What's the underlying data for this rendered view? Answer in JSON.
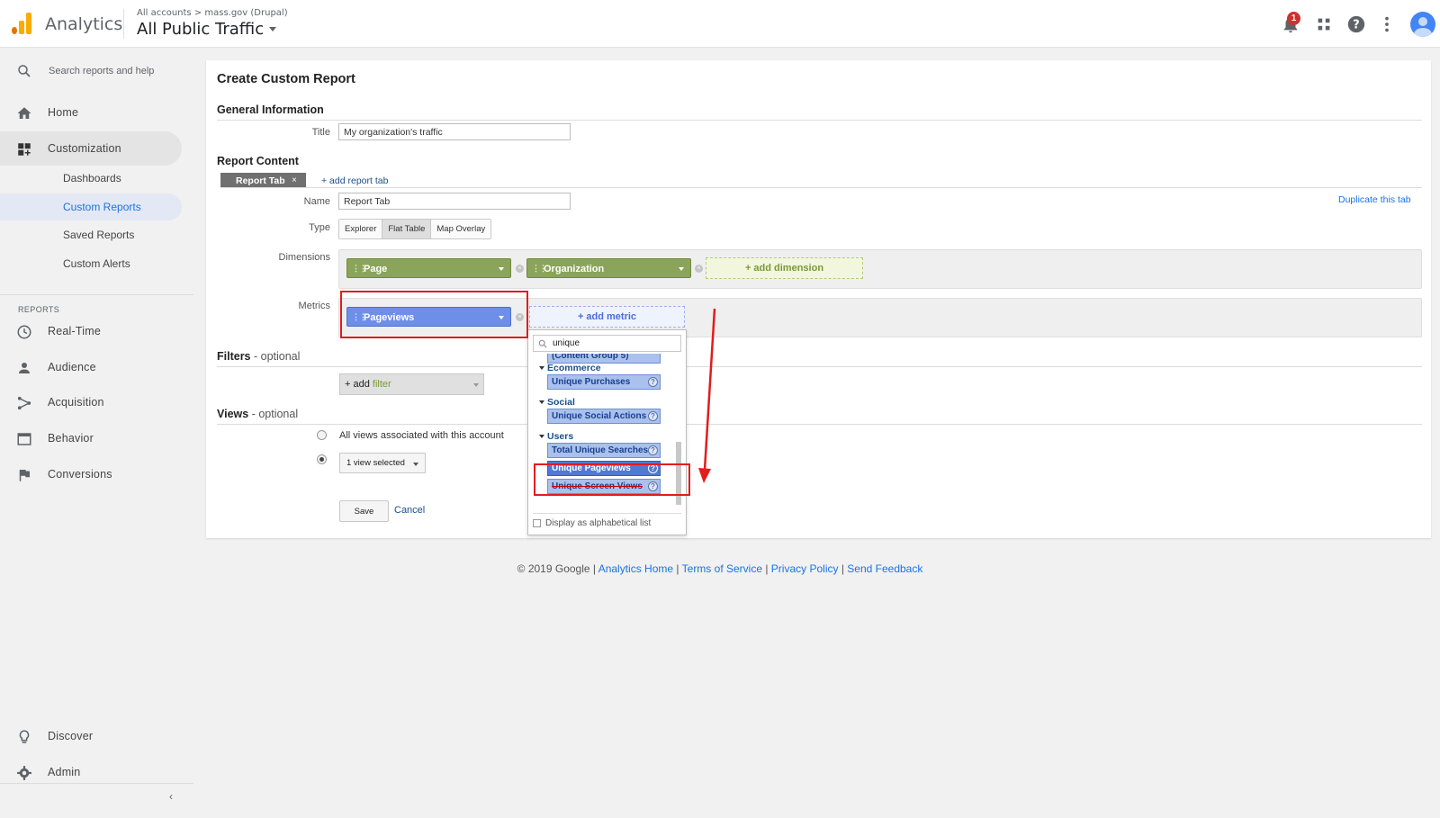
{
  "header": {
    "app_name": "Analytics",
    "breadcrumb": "All accounts > mass.gov (Drupal)",
    "view_name": "All Public Traffic",
    "notification_count": "1"
  },
  "sidebar": {
    "search_placeholder": "Search reports and help",
    "home": "Home",
    "customization": "Customization",
    "sub_items": [
      "Dashboards",
      "Custom Reports",
      "Saved Reports",
      "Custom Alerts"
    ],
    "reports_section": "REPORTS",
    "reports": [
      "Real-Time",
      "Audience",
      "Acquisition",
      "Behavior",
      "Conversions"
    ],
    "discover": "Discover",
    "admin": "Admin"
  },
  "main": {
    "page_title": "Create Custom Report",
    "general_info": "General Information",
    "title_label": "Title",
    "title_value": "My organization's traffic",
    "report_content": "Report Content",
    "report_tab": "Report Tab",
    "add_report_tab": "+ add report tab",
    "duplicate_tab": "Duplicate this tab",
    "name_label": "Name",
    "name_value": "Report Tab",
    "type_label": "Type",
    "types": [
      "Explorer",
      "Flat Table",
      "Map Overlay"
    ],
    "selected_type": "Flat Table",
    "dimensions_label": "Dimensions",
    "dimensions": [
      "Page",
      "Organization"
    ],
    "add_dimension": "+ add dimension",
    "metrics_label": "Metrics",
    "metrics": [
      "Pageviews"
    ],
    "add_metric": "+ add metric",
    "filters_title": "Filters",
    "filters_optional": " - optional",
    "add_filter_prefix": "+ add ",
    "add_filter_word": "filter",
    "views_title": "Views",
    "views_optional": " - optional",
    "views_all": "All views associated with this account",
    "views_selected": "1 view selected",
    "save": "Save",
    "cancel": "Cancel"
  },
  "metric_picker": {
    "search_value": "unique",
    "partial_item": "(Content Group 5)",
    "categories": [
      {
        "name": "Ecommerce",
        "items": [
          "Unique Purchases"
        ]
      },
      {
        "name": "Social",
        "items": [
          "Unique Social Actions"
        ]
      },
      {
        "name": "Users",
        "items": [
          "Total Unique Searches",
          "Unique Pageviews",
          "Unique Screen Views"
        ]
      }
    ],
    "highlighted": "Unique Pageviews",
    "alphabetical_label": "Display as alphabetical list"
  },
  "footer": {
    "copyright": "© 2019 Google |",
    "links": [
      "Analytics Home",
      "Terms of Service",
      "Privacy Policy",
      "Send Feedback"
    ]
  },
  "colors": {
    "accent": "#1a73e8",
    "dimension_pill": "#8aa45a",
    "metric_pill": "#6e8fe8",
    "annotation_red": "#e21c1c",
    "analytics_orange": "#f9ab00"
  }
}
